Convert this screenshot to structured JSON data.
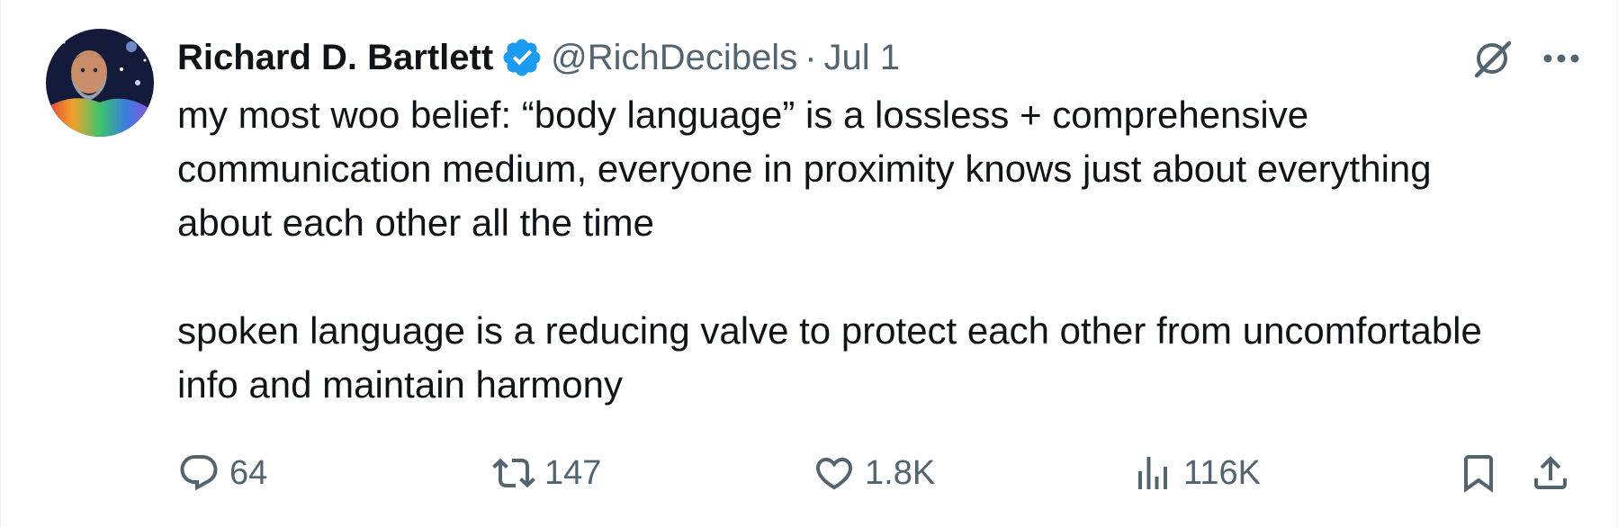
{
  "author": {
    "display_name": "Richard D. Bartlett",
    "handle": "@RichDecibels",
    "separator": "·",
    "date": "Jul 1",
    "verified": true
  },
  "tweet": {
    "text": "my most woo belief: “body language” is a lossless + comprehensive communication medium, everyone in proximity knows just about everything about each other all the time\n\nspoken language is a reducing valve to protect each other from uncomfortable info and maintain harmony"
  },
  "actions": {
    "replies": "64",
    "reposts": "147",
    "likes": "1.8K",
    "views": "116K"
  },
  "icons": [
    "grok-icon",
    "more-icon",
    "reply-icon",
    "repost-icon",
    "like-icon",
    "views-icon",
    "bookmark-icon",
    "share-icon",
    "verified-badge-icon"
  ],
  "colors": {
    "text_primary": "#0f1419",
    "text_secondary": "#536471",
    "verified_blue": "#1d9bf0"
  }
}
